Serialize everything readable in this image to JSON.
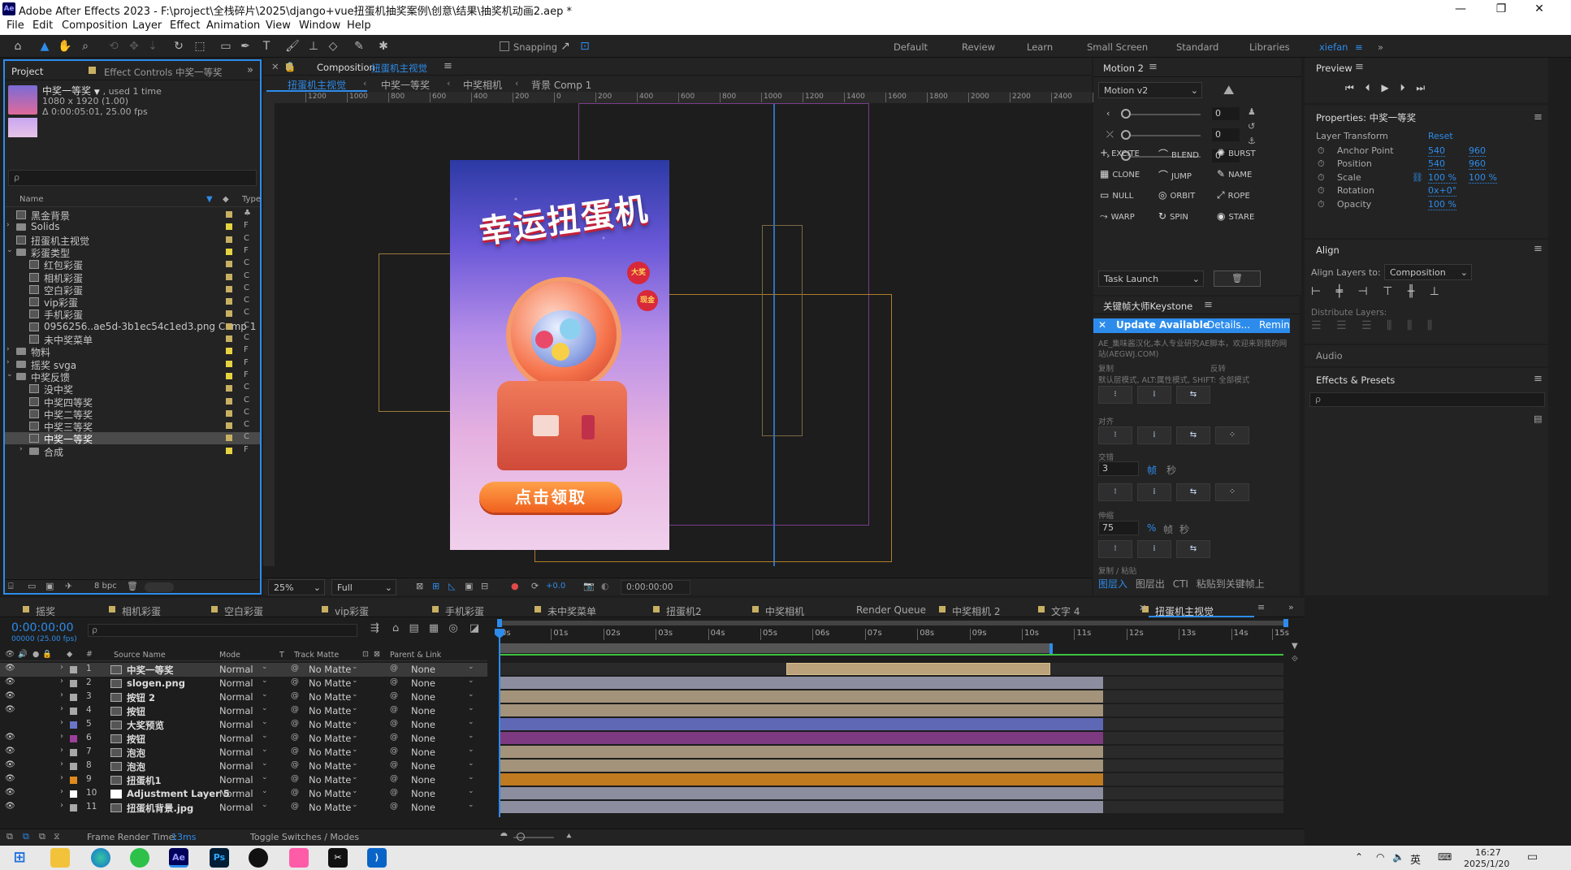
{
  "title_bar": {
    "app_icon": "Ae",
    "title": "Adobe After Effects 2023 - F:\\project\\全栈碎片\\2025\\django+vue扭蛋机抽奖案例\\创意\\结果\\抽奖机动画2.aep *"
  },
  "window_controls": {
    "minimize": "—",
    "restore": "❐",
    "close": "✕"
  },
  "menu": [
    "File",
    "Edit",
    "Composition",
    "Layer",
    "Effect",
    "Animation",
    "View",
    "Window",
    "Help"
  ],
  "toolbar": {
    "snapping_label": "Snapping",
    "workspaces": [
      "Default",
      "Review",
      "Learn",
      "Small Screen",
      "Standard",
      "Libraries"
    ],
    "user": "xiefan",
    "more": "»"
  },
  "project_panel": {
    "tabs": [
      "Project",
      "Effect Controls 中奖一等奖"
    ],
    "item_name": "中奖一等奖",
    "item_used": ", used 1 time",
    "item_dims": "1080 x 1920 (1.00)",
    "item_duration": "Δ 0:00:05:01, 25.00 fps",
    "search_placeholder": "ρ",
    "col_name": "Name",
    "col_type": "Type",
    "items": [
      {
        "label": "黑金背景",
        "indent": 0,
        "kind": "comp",
        "color": "#c8b063",
        "type": "♣"
      },
      {
        "label": "Solids",
        "indent": 0,
        "kind": "folder",
        "color": "#e6d341",
        "type": "F"
      },
      {
        "label": "扭蛋机主视觉",
        "indent": 0,
        "kind": "comp",
        "color": "#c8b063",
        "type": "C"
      },
      {
        "label": "彩蛋类型",
        "indent": 0,
        "kind": "folder-open",
        "color": "#e6d341",
        "type": "F"
      },
      {
        "label": "红包彩蛋",
        "indent": 1,
        "kind": "comp",
        "color": "#c8b063",
        "type": "C"
      },
      {
        "label": "相机彩蛋",
        "indent": 1,
        "kind": "comp",
        "color": "#c8b063",
        "type": "C"
      },
      {
        "label": "空白彩蛋",
        "indent": 1,
        "kind": "comp",
        "color": "#c8b063",
        "type": "C"
      },
      {
        "label": "vip彩蛋",
        "indent": 1,
        "kind": "comp",
        "color": "#c8b063",
        "type": "C"
      },
      {
        "label": "手机彩蛋",
        "indent": 1,
        "kind": "comp",
        "color": "#c8b063",
        "type": "C"
      },
      {
        "label": "0956256..ae5d-3b1ec54c1ed3.png Comp 1",
        "indent": 1,
        "kind": "comp",
        "color": "#c8b063",
        "type": "C"
      },
      {
        "label": "未中奖菜单",
        "indent": 1,
        "kind": "comp",
        "color": "#c8b063",
        "type": "C"
      },
      {
        "label": "物料",
        "indent": 0,
        "kind": "folder",
        "color": "#e6d341",
        "type": "F"
      },
      {
        "label": "摇奖 svga",
        "indent": 0,
        "kind": "folder",
        "color": "#e6d341",
        "type": "F"
      },
      {
        "label": "中奖反馈",
        "indent": 0,
        "kind": "folder-open",
        "color": "#e6d341",
        "type": "F"
      },
      {
        "label": "没中奖",
        "indent": 1,
        "kind": "comp",
        "color": "#c8b063",
        "type": "C"
      },
      {
        "label": "中奖四等奖",
        "indent": 1,
        "kind": "comp",
        "color": "#c8b063",
        "type": "C"
      },
      {
        "label": "中奖二等奖",
        "indent": 1,
        "kind": "comp",
        "color": "#c8b063",
        "type": "C"
      },
      {
        "label": "中奖三等奖",
        "indent": 1,
        "kind": "comp",
        "color": "#c8b063",
        "type": "C"
      },
      {
        "label": "中奖一等奖",
        "indent": 1,
        "kind": "comp",
        "color": "#c8b063",
        "type": "C",
        "selected": true
      },
      {
        "label": "合成",
        "indent": 1,
        "kind": "folder",
        "color": "#e6d341",
        "type": "F"
      }
    ],
    "footer_bpc": "8 bpc"
  },
  "composition_panel": {
    "tab_prefix": "Composition",
    "tab_name": "扭蛋机主视觉",
    "breadcrumbs": [
      "扭蛋机主视觉",
      "中奖一等奖",
      "中奖相机",
      "背景 Comp 1"
    ],
    "ruler_ticks": [
      "1200",
      "1000",
      "800",
      "600",
      "400",
      "200",
      "0",
      "200",
      "400",
      "600",
      "800",
      "1000",
      "1200",
      "1400",
      "1600",
      "1800",
      "2000",
      "2200",
      "2400",
      "260"
    ],
    "poster_title": "幸运扭蛋机",
    "poster_button": "点击领取",
    "badge_1": "大奖",
    "badge_2": "现金",
    "zoom": "25%",
    "resolution": "Full",
    "exposure": "+0.0",
    "timecode": "0:00:00:00"
  },
  "motion_panel": {
    "title": "Motion 2",
    "preset": "Motion v2",
    "slider_values": [
      "0",
      "0",
      "0"
    ],
    "buttons": [
      "EXCITE",
      "BLEND",
      "BURST",
      "CLONE",
      "JUMP",
      "NAME",
      "NULL",
      "ORBIT",
      "ROPE",
      "WARP",
      "SPIN",
      "STARE"
    ],
    "task": "Task Launch"
  },
  "keystone_panel": {
    "title": "关键帧大师Keystone",
    "update_text": "Update Available",
    "details": "Details...",
    "remind": "Remind",
    "desc": "AE_集味酱汉化,本人专业研究AE脚本，欢迎来到我的网站(AEGWJ.COM)",
    "copy_label": "复制",
    "reverse_label": "反转",
    "mode_hint": "默认层模式, ALT:属性模式, SHIFT: 全部模式",
    "align_label": "对齐",
    "stagger_label": "交错",
    "stagger_value": "3",
    "frames": "帧",
    "seconds": "秒",
    "stretch_label": "伸缩",
    "stretch_value": "75",
    "percent": "%",
    "paste_label": "复制 / 粘贴",
    "paste_actions": [
      "图层入",
      "图层出",
      "CTI",
      "粘贴到关键帧上"
    ]
  },
  "preview_panel": {
    "title": "Preview"
  },
  "properties_panel": {
    "title": "Properties: 中奖一等奖",
    "section": "Layer Transform",
    "reset": "Reset",
    "props": [
      {
        "label": "Anchor Point",
        "v1": "540",
        "v2": "960"
      },
      {
        "label": "Position",
        "v1": "540",
        "v2": "960"
      },
      {
        "label": "Scale",
        "v1": "100 %",
        "v2": "100 %"
      },
      {
        "label": "Rotation",
        "v1": "0x+0°",
        "v2": ""
      },
      {
        "label": "Opacity",
        "v1": "100 %",
        "v2": ""
      }
    ]
  },
  "align_panel": {
    "title": "Align",
    "align_to_label": "Align Layers to:",
    "align_to_value": "Composition",
    "distribute_label": "Distribute Layers:"
  },
  "audio_panel": {
    "title": "Audio"
  },
  "effects_panel": {
    "title": "Effects & Presets",
    "search_placeholder": "ρ"
  },
  "timeline": {
    "tabs": [
      "摇奖",
      "相机彩蛋",
      "空白彩蛋",
      "vip彩蛋",
      "手机彩蛋",
      "未中奖菜单",
      "扭蛋机2",
      "中奖相机",
      "Render Queue",
      "中奖相机 2",
      "文字 4",
      "扭蛋机主视觉"
    ],
    "timecode": "0:00:00:00",
    "fps": "00000 (25.00 fps)",
    "search_placeholder": "ρ",
    "col_source": "Source Name",
    "col_mode": "Mode",
    "col_t": "T",
    "col_trackmatte": "Track Matte",
    "col_parent": "Parent & Link",
    "ruler": [
      "0s",
      "01s",
      "02s",
      "03s",
      "04s",
      "05s",
      "06s",
      "07s",
      "08s",
      "09s",
      "10s",
      "11s",
      "12s",
      "13s",
      "14s",
      "15s"
    ],
    "layers": [
      {
        "num": "1",
        "name": "中奖一等奖",
        "kind": "comp",
        "color": "#a8a8a8",
        "mode": "Normal",
        "matte": "No Matte",
        "parent": "None",
        "bar_color": "#bca27a",
        "bar_start": 5.5,
        "bar_end": 10.55,
        "selected": true
      },
      {
        "num": "2",
        "name": "slogen.png",
        "kind": "file",
        "color": "#a8a8a8",
        "mode": "Normal",
        "matte": "No Matte",
        "parent": "None",
        "bar_color": "#8d8da0",
        "bar_start": 0,
        "bar_end": 11.55
      },
      {
        "num": "3",
        "name": "按钮 2",
        "kind": "comp",
        "color": "#a8a8a8",
        "mode": "Normal",
        "matte": "No Matte",
        "parent": "None",
        "bar_color": "#a3937a",
        "bar_start": 0,
        "bar_end": 11.55
      },
      {
        "num": "4",
        "name": "按钮",
        "kind": "comp",
        "color": "#a8a8a8",
        "mode": "Normal",
        "matte": "No Matte",
        "parent": "None",
        "bar_color": "#a3937a",
        "bar_start": 0,
        "bar_end": 11.55
      },
      {
        "num": "5",
        "name": "大奖预览",
        "kind": "comp",
        "color": "#6a74c8",
        "mode": "Normal",
        "matte": "No Matte",
        "parent": "None",
        "bar_color": "#5f68b5",
        "bar_start": 0,
        "bar_end": 11.55
      },
      {
        "num": "6",
        "name": "按钮",
        "kind": "comp",
        "color": "#9a3f9a",
        "mode": "Normal",
        "matte": "No Matte",
        "parent": "None",
        "bar_color": "#7d3a80",
        "bar_start": 0,
        "bar_end": 11.55
      },
      {
        "num": "7",
        "name": "泡泡",
        "kind": "comp",
        "color": "#a8a8a8",
        "mode": "Normal",
        "matte": "No Matte",
        "parent": "None",
        "bar_color": "#a3937a",
        "bar_start": 0,
        "bar_end": 11.55
      },
      {
        "num": "8",
        "name": "泡泡",
        "kind": "comp",
        "color": "#a8a8a8",
        "mode": "Normal",
        "matte": "No Matte",
        "parent": "None",
        "bar_color": "#a3937a",
        "bar_start": 0,
        "bar_end": 11.55
      },
      {
        "num": "9",
        "name": "扭蛋机1",
        "kind": "comp",
        "color": "#e08a1e",
        "mode": "Normal",
        "matte": "No Matte",
        "parent": "None",
        "bar_color": "#c07a20",
        "bar_start": 0,
        "bar_end": 11.55
      },
      {
        "num": "10",
        "name": "Adjustment Layer 5",
        "kind": "solid",
        "color": "#ffffff",
        "mode": "Normal",
        "matte": "No Matte",
        "parent": "None",
        "bar_color": "#8d8da0",
        "bar_start": 0,
        "bar_end": 11.55
      },
      {
        "num": "11",
        "name": "扭蛋机背景.jpg",
        "kind": "file",
        "color": "#a8a8a8",
        "mode": "Normal",
        "matte": "No Matte",
        "parent": "None",
        "bar_color": "#8d8da0",
        "bar_start": 0,
        "bar_end": 11.55
      }
    ],
    "footer_render_label": "Frame Render Time:",
    "footer_render_value": "13ms",
    "footer_toggle": "Toggle Switches / Modes"
  },
  "taskbar": {
    "ime": "英",
    "time": "16:27",
    "date": "2025/1/20"
  }
}
